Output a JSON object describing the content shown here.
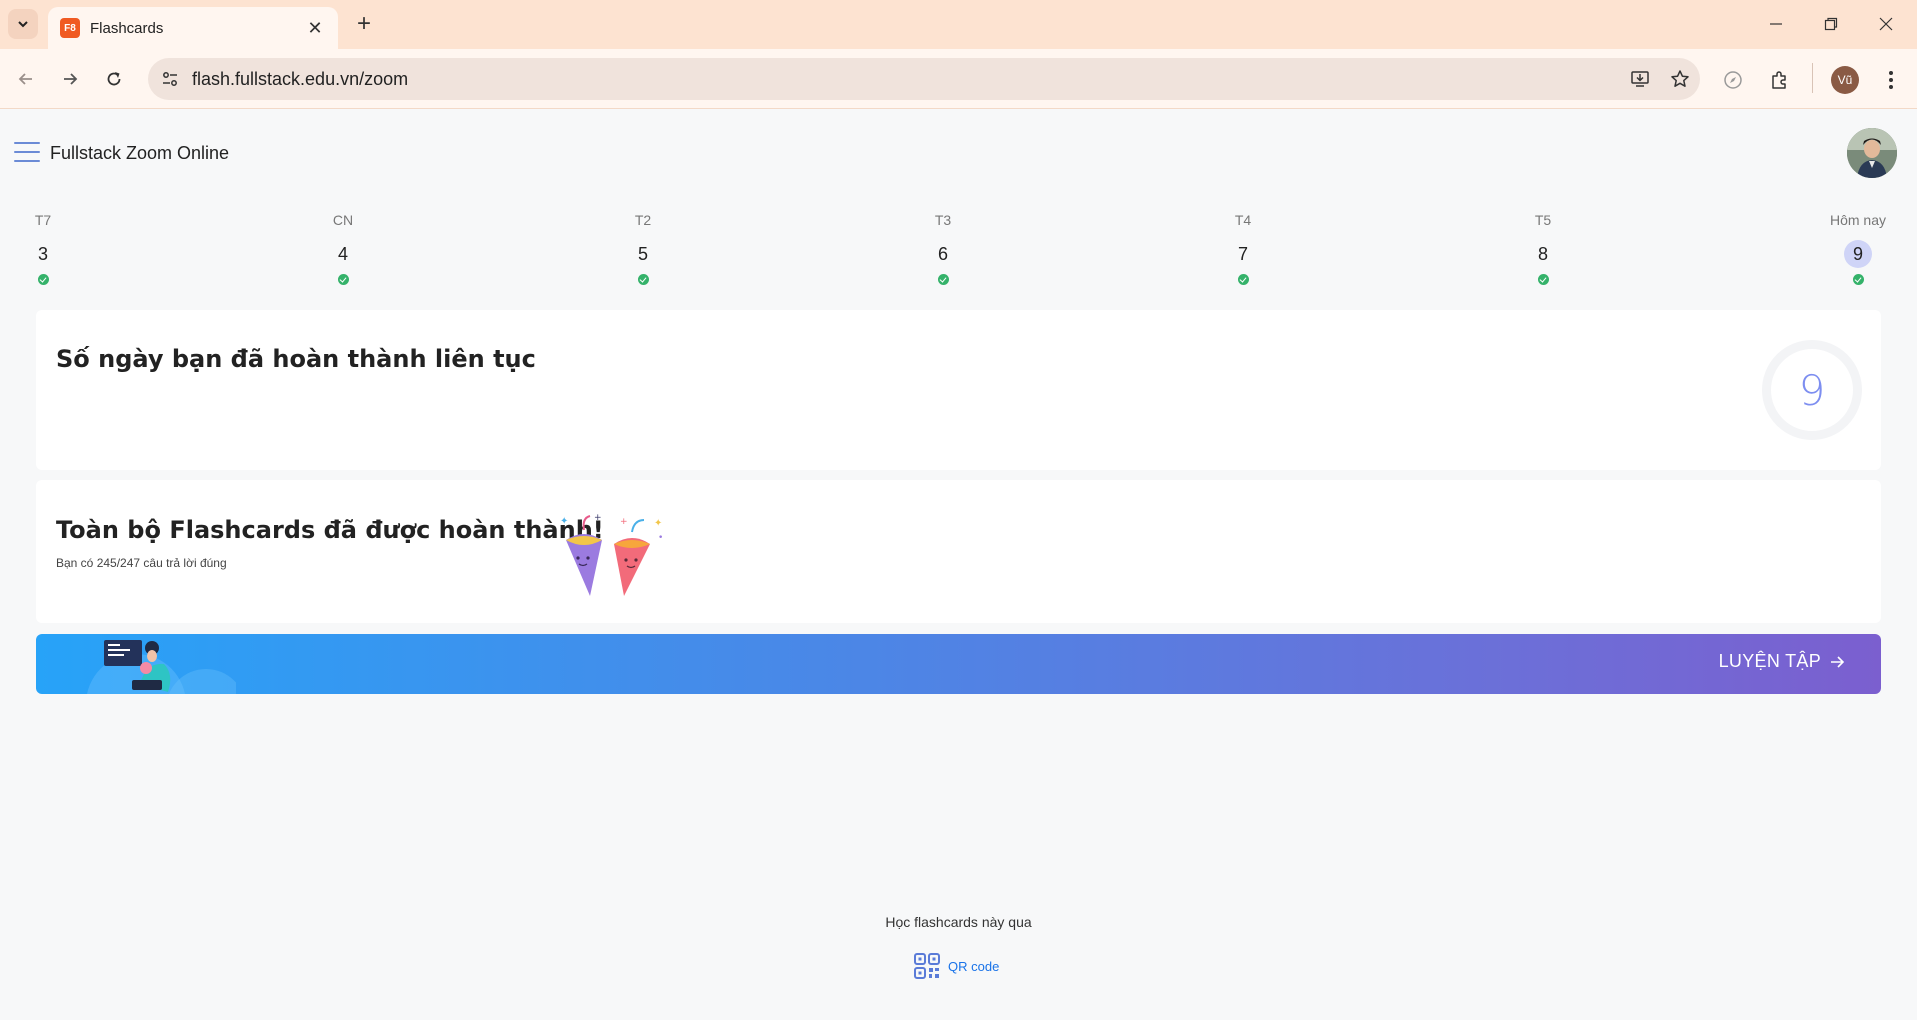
{
  "browser": {
    "tab_title": "Flashcards",
    "tab_favicon_text": "F8",
    "url": "flash.fullstack.edu.vn/zoom",
    "profile_initials": "Vũ"
  },
  "header": {
    "title": "Fullstack Zoom Online"
  },
  "days": [
    {
      "name": "T7",
      "num": "3",
      "today": false,
      "completed": true
    },
    {
      "name": "CN",
      "num": "4",
      "today": false,
      "completed": true
    },
    {
      "name": "T2",
      "num": "5",
      "today": false,
      "completed": true
    },
    {
      "name": "T3",
      "num": "6",
      "today": false,
      "completed": true
    },
    {
      "name": "T4",
      "num": "7",
      "today": false,
      "completed": true
    },
    {
      "name": "T5",
      "num": "8",
      "today": false,
      "completed": true
    },
    {
      "name": "Hôm nay",
      "num": "9",
      "today": true,
      "completed": true
    }
  ],
  "streak": {
    "title": "Số ngày bạn đã hoàn thành liên tục",
    "value": "9"
  },
  "completion": {
    "title": "Toàn bộ Flashcards đã được hoàn thành!",
    "subtitle": "Bạn có 245/247 câu trả lời đúng"
  },
  "practice": {
    "label": "LUYỆN TẬP"
  },
  "footer": {
    "text": "Học flashcards này qua",
    "qr_label": "QR code"
  },
  "colors": {
    "accent": "#7d8ef0",
    "check": "#34b26a",
    "link": "#1a73e8",
    "tab_bar": "#fde3d1"
  }
}
